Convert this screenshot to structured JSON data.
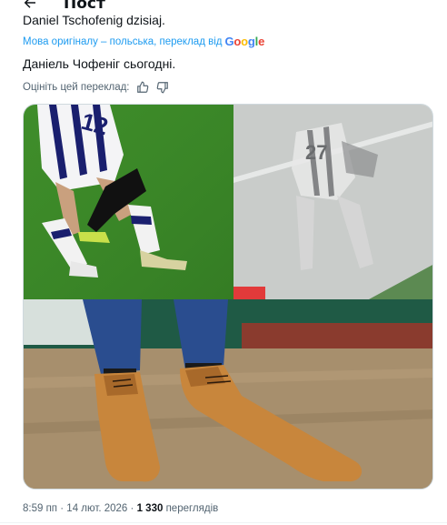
{
  "header": {
    "title": "Пост"
  },
  "post": {
    "original_text": "Daniel Tschofenig dzisiaj.",
    "translation_note": "Мова оригіналу – польська, переклад від",
    "translation_provider": "Google",
    "translated_text": "Даніель Чофеніг сьогодні.",
    "rate_prompt": "Оцініть цей переклад:",
    "time": "8:59 пп",
    "date": "14 лют. 2026",
    "views_count": "1 330",
    "views_label": "переглядів",
    "separator": "·"
  },
  "media": {
    "jersey_number": "27",
    "accent_pitch": "#3f8d2a",
    "shoe_color": "#c8863c"
  },
  "icons": {
    "back": "arrow-left-icon",
    "like": "thumbs-up-icon",
    "dislike": "thumbs-down-icon"
  }
}
